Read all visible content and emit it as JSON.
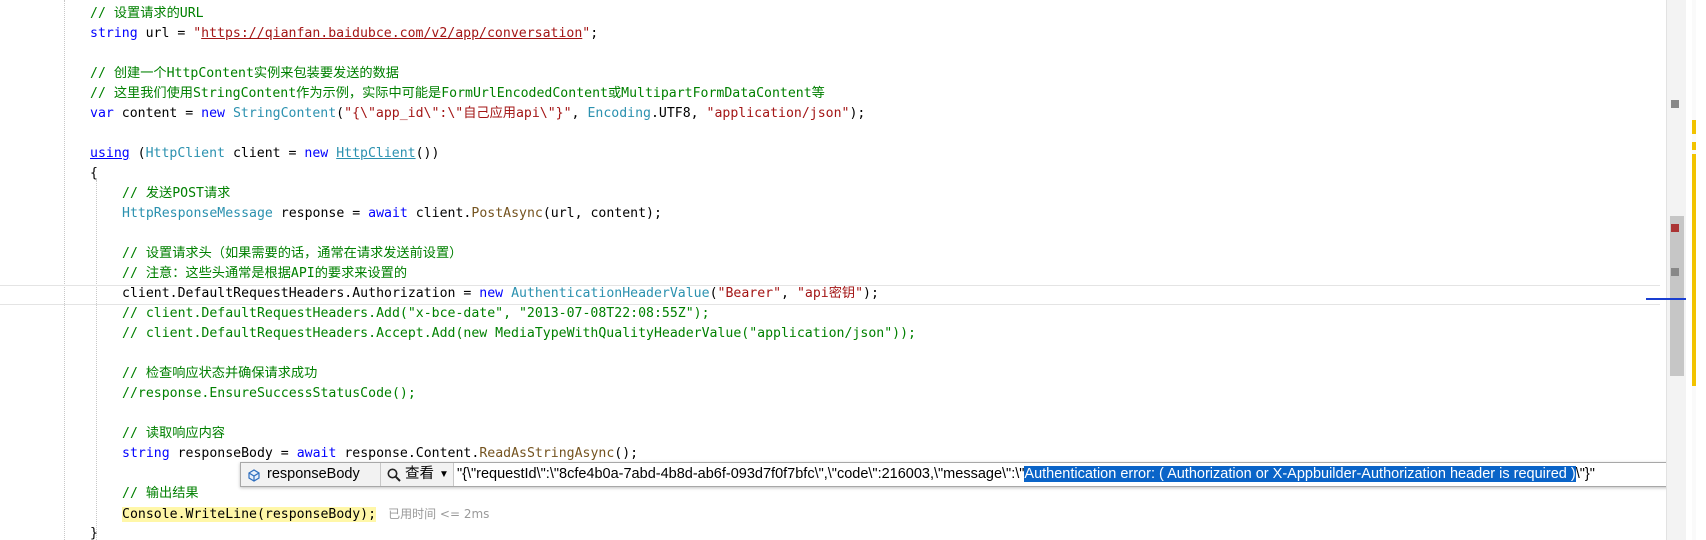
{
  "code": {
    "l1": "// 设置请求的URL",
    "l2_kw": "string",
    "l2_var": " url = ",
    "l2_q1": "\"",
    "l2_url": "https://qianfan.baidubce.com/v2/app/conversation",
    "l2_q2": "\"",
    "l2_end": ";",
    "l4": "// 创建一个HttpContent实例来包装要发送的数据",
    "l5": "// 这里我们使用StringContent作为示例，实际中可能是FormUrlEncodedContent或MultipartFormDataContent等",
    "l6_var": "var",
    "l6_a": " content = ",
    "l6_new": "new",
    "l6_type": "StringContent",
    "l6_b": "(",
    "l6_str": "\"{\\\"app_id\\\":\\\"自己应用api\\\"}\"",
    "l6_c": ", ",
    "l6_enc": "Encoding",
    "l6_d": ".UTF8, ",
    "l6_str2": "\"application/json\"",
    "l6_e": ");",
    "l8_using": "using",
    "l8_a": " (",
    "l8_type": "HttpClient",
    "l8_b": " client = ",
    "l8_new": "new",
    "l8_type2": "HttpClient",
    "l8_c": "())",
    "l9": "{",
    "l10": "// 发送POST请求",
    "l11_type": "HttpResponseMessage",
    "l11_a": " response = ",
    "l11_await": "await",
    "l11_b": " client.",
    "l11_m": "PostAsync",
    "l11_c": "(url, content);",
    "l13": "// 设置请求头（如果需要的话，通常在请求发送前设置）",
    "l14": "// 注意：这些头通常是根据API的要求来设置的",
    "l15_a": "client.DefaultRequestHeaders.Authorization = ",
    "l15_new": "new",
    "l15_type": "AuthenticationHeaderValue",
    "l15_b": "(",
    "l15_s1": "\"Bearer\"",
    "l15_c": ", ",
    "l15_s2": "\"api密钥\"",
    "l15_d": ");",
    "l16": "// client.DefaultRequestHeaders.Add(\"x-bce-date\", \"2013-07-08T22:08:55Z\");",
    "l17": "// client.DefaultRequestHeaders.Accept.Add(new MediaTypeWithQualityHeaderValue(\"application/json\"));",
    "l19": "// 检查响应状态并确保请求成功",
    "l20": "//response.EnsureSuccessStatusCode();",
    "l22": "// 读取响应内容",
    "l23_kw": "string",
    "l23_a": " responseBody = ",
    "l23_await": "await",
    "l23_b": " response.Content.",
    "l23_m": "ReadAsStringAsync",
    "l23_c": "();",
    "l25": "// 输出结果",
    "l26": "Console.WriteLine(responseBody);",
    "l26_elapsed": "已用时间 <= 2ms",
    "l27": "}"
  },
  "datatip": {
    "name": "responseBody",
    "view_label": "查看",
    "value_prefix": "\"{\\\"requestId\\\":\\\"8cfe4b0a-7abd-4b8d-ab6f-093d7f0f7bfc\\\",\\\"code\\\":216003,\\\"message\\\":\\\"",
    "value_selected": "Authentication error: ( Authorization or X-Appbuilder-Authorization header is required )",
    "value_suffix": "\\\"}\""
  },
  "icons": {
    "name_icon": "variable-icon",
    "view_icon": "magnifier-icon",
    "dropdown_icon": "chevron-down-icon"
  },
  "colors": {
    "comment": "#008000",
    "keyword": "#0000ff",
    "type": "#2b91af",
    "string": "#a31515",
    "selection": "#0a64c8"
  }
}
